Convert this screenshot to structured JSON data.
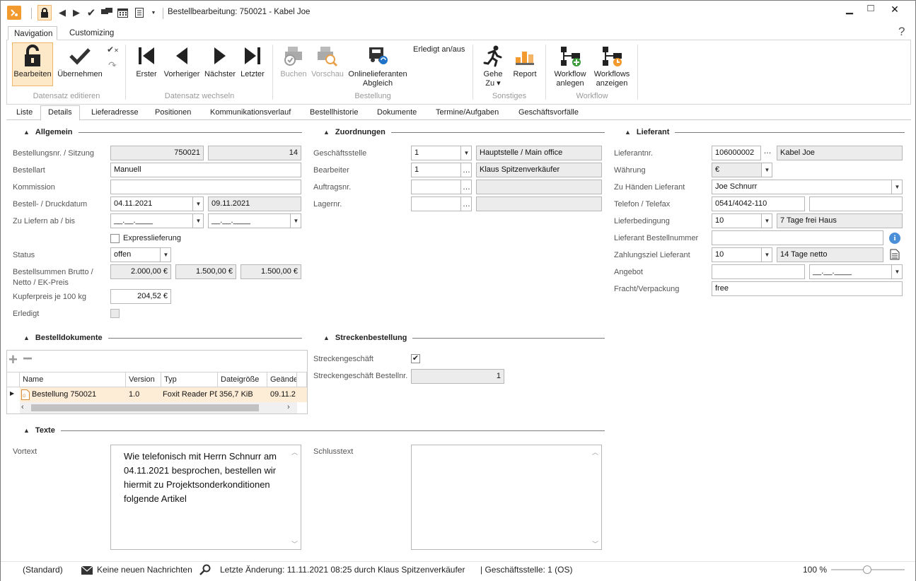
{
  "window": {
    "title": "Bestellbearbeitung: 750021 - Kabel Joe",
    "minimize": "▁",
    "maximize": "□",
    "close": "✕",
    "help": "?"
  },
  "ribbon_tabs": [
    "Navigation",
    "Customizing"
  ],
  "ribbon": {
    "edit": {
      "bearbeiten": "Bearbeiten",
      "uebernehmen": "Übernehmen",
      "group": "Datensatz editieren"
    },
    "nav": {
      "erster": "Erster",
      "vorheriger": "Vorheriger",
      "naechster": "Nächster",
      "letzter": "Letzter",
      "group": "Datensatz wechseln"
    },
    "bestellung": {
      "buchen": "Buchen",
      "vorschau": "Vorschau",
      "online1": "Onlinelieferanten",
      "online2": "Abgleich",
      "erledigt": "Erledigt an/aus",
      "group": "Bestellung"
    },
    "sonstiges": {
      "gehe1": "Gehe",
      "gehe2": "Zu ▾",
      "report": "Report",
      "group": "Sonstiges"
    },
    "workflow": {
      "anlegen1": "Workflow",
      "anlegen2": "anlegen",
      "anzeigen1": "Workflows",
      "anzeigen2": "anzeigen",
      "group": "Workflow"
    }
  },
  "form_tabs": [
    "Liste",
    "Details",
    "Lieferadresse",
    "Positionen",
    "Kommunikationsverlauf",
    "Bestellhistorie",
    "Dokumente",
    "Termine/Aufgaben",
    "Geschäftsvorfälle"
  ],
  "allgemein": {
    "title": "Allgemein",
    "bestellnr_label": "Bestellungsnr. / Sitzung",
    "bestellnr": "750021",
    "sitzung": "14",
    "bestellart_label": "Bestellart",
    "bestellart": "Manuell",
    "kommission_label": "Kommission",
    "kommission": "",
    "datum_label": "Bestell- / Druckdatum",
    "bestelldatum": "04.11.2021",
    "druckdatum": "09.11.2021",
    "liefern_label": "Zu Liefern ab / bis",
    "liefern_ab": "__.__.____",
    "liefern_bis": "__.__.____",
    "express_label": "Expresslieferung",
    "status_label": "Status",
    "status": "offen",
    "summen_label1": "Bestellsummen Brutto /",
    "summen_label2": "Netto / EK-Preis",
    "brutto": "2.000,00 €",
    "netto": "1.500,00 €",
    "ek": "1.500,00 €",
    "kupfer_label": "Kupferpreis je 100 kg",
    "kupfer": "204,52 €",
    "erledigt_label": "Erledigt"
  },
  "zuordnungen": {
    "title": "Zuordnungen",
    "gs_label": "Geschäftsstelle",
    "gs": "1",
    "gs_name": "Hauptstelle / Main office",
    "bearb_label": "Bearbeiter",
    "bearb": "1",
    "bearb_name": "Klaus Spitzenverkäufer",
    "auftrag_label": "Auftragsnr.",
    "lager_label": "Lagernr."
  },
  "lieferant": {
    "title": "Lieferant",
    "nr_label": "Lieferantnr.",
    "nr": "106000002",
    "name": "Kabel Joe",
    "waehrung_label": "Währung",
    "waehrung": "€",
    "zuhaenden_label": "Zu Händen Lieferant",
    "zuhaenden": "Joe Schnurr",
    "telefon_label": "Telefon / Telefax",
    "telefon": "0541/4042-110",
    "telefax": "",
    "liefbed_label": "Lieferbedingung",
    "liefbed": "10",
    "liefbed_text": "7 Tage frei Haus",
    "bestnr_label": "Lieferant Bestellnummer",
    "bestnr": "",
    "zahlung_label": "Zahlungsziel Lieferant",
    "zahlung": "10",
    "zahlung_text": "14 Tage netto",
    "angebot_label": "Angebot",
    "angebot": "",
    "angebot_datum": "__.__.____",
    "fracht_label": "Fracht/Verpackung",
    "fracht": "free"
  },
  "dokumente": {
    "title": "Bestelldokumente",
    "columns": [
      "Name",
      "Version",
      "Typ",
      "Dateigröße",
      "Geände"
    ],
    "rows": [
      {
        "name": "Bestellung 750021",
        "version": "1.0",
        "typ": "Foxit Reader PDF",
        "groesse": "356,7 KiB",
        "geaendert": "09.11.2"
      }
    ]
  },
  "strecke": {
    "title": "Streckenbestellung",
    "geschaeft_label": "Streckengeschäft",
    "bestnr_label": "Streckengeschäft Bestellnr.",
    "bestnr": "1"
  },
  "texte": {
    "title": "Texte",
    "vortext_label": "Vortext",
    "vortext": "Wie telefonisch mit Herrn Schnurr am 04.11.2021 besprochen, bestellen wir hiermit zu Projektsonderkonditionen folgende Artikel",
    "schlusstext_label": "Schlusstext",
    "schlusstext": ""
  },
  "status": {
    "standard": "(Standard)",
    "nachrichten": "Keine neuen Nachrichten",
    "aenderung": "Letzte Änderung: 11.11.2021 08:25 durch Klaus Spitzenverkäufer",
    "gs": "| Geschäftsstelle:  1 (OS)",
    "zoom": "100 %"
  }
}
